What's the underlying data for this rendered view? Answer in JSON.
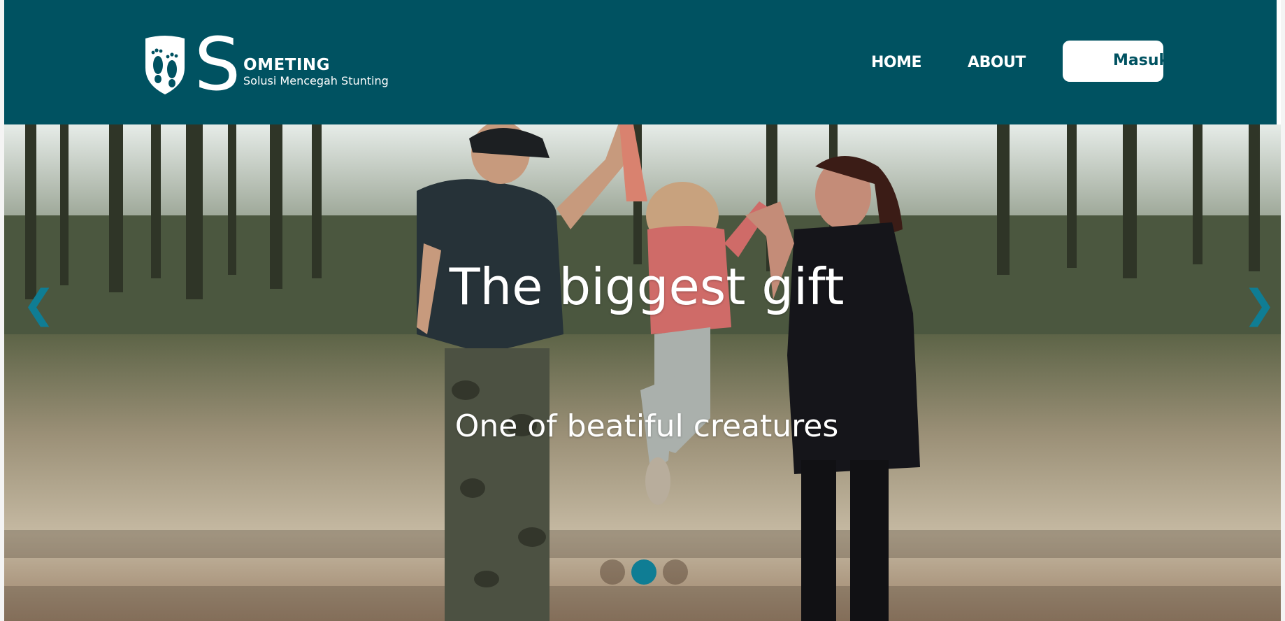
{
  "brand": {
    "letter": "S",
    "name": "OMETING",
    "tagline": "Solusi Mencegah Stunting",
    "logo_icon": "footprints-shield-icon"
  },
  "nav": {
    "items": [
      {
        "label": "HOME"
      },
      {
        "label": "ABOUT"
      }
    ],
    "login_label": "Masuk"
  },
  "hero": {
    "title": "The biggest gift",
    "subtitle": "One of beatiful creatures",
    "prev_icon": "chevron-left-icon",
    "next_icon": "chevron-right-icon",
    "prev_glyph": "❮",
    "next_glyph": "❯",
    "slide_count": 3,
    "active_slide": 2
  },
  "colors": {
    "navbar": "#005261",
    "accent": "#0f7d94",
    "text_light": "#ffffff"
  }
}
